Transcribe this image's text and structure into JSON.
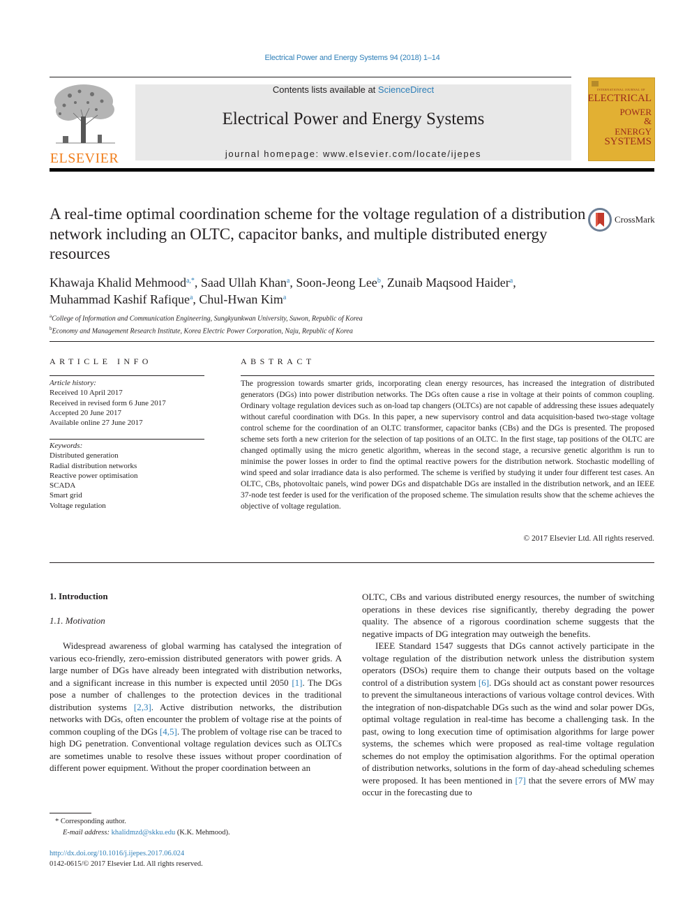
{
  "journal_reference": "Electrical Power and Energy Systems 94 (2018) 1–14",
  "header": {
    "publisher_logo_text": "ELSEVIER",
    "contents_prefix": "Contents lists available at ",
    "contents_link": "ScienceDirect",
    "journal_title": "Electrical Power and Energy Systems",
    "homepage_label": "journal homepage: www.elsevier.com/locate/ijepes",
    "cover": {
      "top_line": "INTERNATIONAL JOURNAL OF",
      "lines": [
        "ELECTRICAL",
        "POWER",
        "&",
        "ENERGY",
        "SYSTEMS"
      ]
    }
  },
  "article": {
    "title": "A real-time optimal coordination scheme for the voltage regulation of a distribution network including an OLTC, capacitor banks, and multiple distributed energy resources",
    "crossmark_label": "CrossMark",
    "authors": [
      {
        "name": "Khawaja Khalid Mehmood",
        "sup": "a,*",
        "sep": ", "
      },
      {
        "name": "Saad Ullah Khan",
        "sup": "a",
        "sep": ", "
      },
      {
        "name": "Soon-Jeong Lee",
        "sup": "b",
        "sep": ", "
      },
      {
        "name": "Zunaib Maqsood Haider",
        "sup": "a",
        "sep": ","
      },
      {
        "name": "Muhammad Kashif Rafique",
        "sup": "a",
        "sep": ", "
      },
      {
        "name": "Chul-Hwan Kim",
        "sup": "a",
        "sep": ""
      }
    ],
    "affiliations": [
      {
        "sup": "a",
        "text": "College of Information and Communication Engineering, Sungkyunkwan University, Suwon, Republic of Korea"
      },
      {
        "sup": "b",
        "text": "Economy and Management Research Institute, Korea Electric Power Corporation, Naju, Republic of Korea"
      }
    ]
  },
  "article_info": {
    "heading": "ARTICLE INFO",
    "history_label": "Article history:",
    "history": [
      "Received 10 April 2017",
      "Received in revised form 6 June 2017",
      "Accepted 20 June 2017",
      "Available online 27 June 2017"
    ],
    "keywords_label": "Keywords:",
    "keywords": [
      "Distributed generation",
      "Radial distribution networks",
      "Reactive power optimisation",
      "SCADA",
      "Smart grid",
      "Voltage regulation"
    ]
  },
  "abstract": {
    "heading": "ABSTRACT",
    "text": "The progression towards smarter grids, incorporating clean energy resources, has increased the integration of distributed generators (DGs) into power distribution networks. The DGs often cause a rise in voltage at their points of common coupling. Ordinary voltage regulation devices such as on-load tap changers (OLTCs) are not capable of addressing these issues adequately without careful coordination with DGs. In this paper, a new supervisory control and data acquisition-based two-stage voltage control scheme for the coordination of an OLTC transformer, capacitor banks (CBs) and the DGs is presented. The proposed scheme sets forth a new criterion for the selection of tap positions of an OLTC. In the first stage, tap positions of the OLTC are changed optimally using the micro genetic algorithm, whereas in the second stage, a recursive genetic algorithm is run to minimise the power losses in order to find the optimal reactive powers for the distribution network. Stochastic modelling of wind speed and solar irradiance data is also performed. The scheme is verified by studying it under four different test cases. An OLTC, CBs, photovoltaic panels, wind power DGs and dispatchable DGs are installed in the distribution network, and an IEEE 37-node test feeder is used for the verification of the proposed scheme. The simulation results show that the scheme achieves the objective of voltage regulation.",
    "copyright": "© 2017 Elsevier Ltd. All rights reserved."
  },
  "body": {
    "section_heading": "1. Introduction",
    "subsection_heading": "1.1. Motivation",
    "left_column": [
      {
        "t": "Widespread awareness of global warming has catalysed the integration of various eco-friendly, zero-emission distributed generators with power grids. A large number of DGs have already been integrated with distribution networks, and a significant increase in this number is expected until 2050 "
      },
      {
        "ref": "[1]"
      },
      {
        "t": ". The DGs pose a number of challenges to the protection devices in the traditional distribution systems "
      },
      {
        "ref": "[2,3]"
      },
      {
        "t": ". Active distribution networks, the distribution networks with DGs, often encounter the problem of voltage rise at the points of common coupling of the DGs "
      },
      {
        "ref": "[4,5]"
      },
      {
        "t": ". The problem of voltage rise can be traced to high DG penetration. Conventional voltage regulation devices such as OLTCs are sometimes unable to resolve these issues without proper coordination of different power equipment. Without the proper coordination between an"
      }
    ],
    "right_column_p1": "OLTC, CBs and various distributed energy resources, the number of switching operations in these devices rise significantly, thereby degrading the power quality. The absence of a rigorous coordination scheme suggests that the negative impacts of DG integration may outweigh the benefits.",
    "right_column_p2": [
      {
        "t": "IEEE Standard 1547 suggests that DGs cannot actively participate in the voltage regulation of the distribution network unless the distribution system operators (DSOs) require them to change their outputs based on the voltage control of a distribution system "
      },
      {
        "ref": "[6]"
      },
      {
        "t": ". DGs should act as constant power resources to prevent the simultaneous interactions of various voltage control devices. With the integration of non-dispatchable DGs such as the wind and solar power DGs, optimal voltage regulation in real-time has become a challenging task. In the past, owing to long execution time of optimisation algorithms for large power systems, the schemes which were proposed as real-time voltage regulation schemes do not employ the optimisation algorithms. For the optimal operation of distribution networks, solutions in the form of day-ahead scheduling schemes were proposed. It has been mentioned in "
      },
      {
        "ref": "[7]"
      },
      {
        "t": " that the severe errors of MW may occur in the forecasting due to"
      }
    ]
  },
  "footnotes": {
    "corresponding_marker": "*",
    "corresponding_text": "Corresponding author.",
    "email_label": "E-mail address:",
    "email": "khalidmzd@skku.edu",
    "email_owner": "(K.K. Mehmood).",
    "doi_link": "http://dx.doi.org/10.1016/j.ijepes.2017.06.024",
    "issn_line": "0142-0615/© 2017 Elsevier Ltd. All rights reserved."
  },
  "colors": {
    "link": "#2e7fb8",
    "elsevier_orange": "#f07d1a",
    "cover_gold": "#e2b033",
    "cover_red": "#9b2a1c",
    "masthead_gray": "#e8e8e8"
  }
}
